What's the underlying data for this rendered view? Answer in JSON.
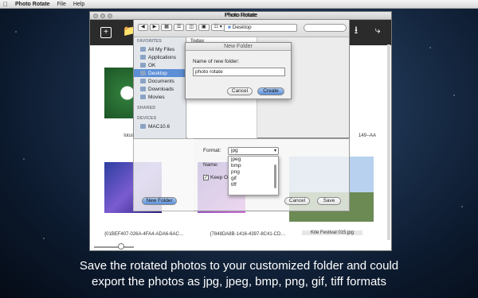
{
  "menubar": {
    "apple": "",
    "app_name": "Photo Rotate",
    "items": [
      "File",
      "Help"
    ]
  },
  "window": {
    "title": "Photo Rotate"
  },
  "toolbar_icons": [
    "plus-icon",
    "folder-icon",
    "download-icon",
    "share-icon"
  ],
  "finder": {
    "title": "Photo Rotate",
    "path": "Desktop",
    "column_header": "Today",
    "sidebar": {
      "favorites_header": "FAVORITES",
      "favorites": [
        "All My Files",
        "Applications",
        "OK",
        "Desktop",
        "Documents",
        "Downloads",
        "Movies"
      ],
      "selected": "Desktop",
      "shared_header": "SHARED",
      "devices_header": "DEVICES",
      "devices": [
        "MAC10.6"
      ]
    }
  },
  "new_folder_sheet": {
    "title": "New Folder",
    "label": "Name of new folder:",
    "value": "photo rotate",
    "cancel": "Cancel",
    "create": "Create"
  },
  "save_panel": {
    "format_label": "Format:",
    "format_value": "jpg",
    "format_options": [
      "jpeg",
      "bmp",
      "png",
      "gif",
      "tiff"
    ],
    "name_label": "Name:",
    "keep_label": "Keep O",
    "new_folder": "New Folder",
    "cancel": "Cancel",
    "save": "Save"
  },
  "gallery": {
    "captions": [
      "lotus-flow",
      "149--AA",
      "{01BEF407-026A-4FA4-ADA6-6AC…",
      "{7848DA8B-1416-4397-8C41-CD…",
      "Kite Festival 015.jpg"
    ]
  },
  "caption": {
    "line1": "Save the rotated photos to your customized folder and could",
    "line2": "export the photos as jpg, jpeg, bmp, png, gif, tiff formats"
  }
}
